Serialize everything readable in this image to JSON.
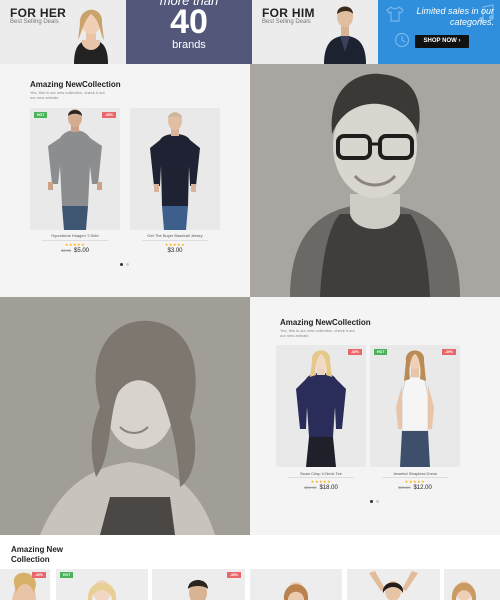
{
  "banner": {
    "her": {
      "title": "FOR HER",
      "subtitle": "Best Selling Deals"
    },
    "brands": {
      "top": "more than",
      "number": "40",
      "bottom": "brands"
    },
    "him": {
      "title": "FOR HIM",
      "subtitle": "Best Selling Deals"
    },
    "sale": {
      "text": "Limited sales in our categories.",
      "button": "SHOP NOW ›",
      "icons": [
        "t-shirt-icon",
        "music-note-icon",
        "clock-icon"
      ]
    }
  },
  "collection_1": {
    "title": "Amazing NewCollection",
    "description": "Yes, this is our new collection, check it out our new arrivals",
    "products": [
      {
        "name": "Hyundreds Hoagen T-Shirt",
        "badge_left": "HOT",
        "badge_right": "-30%",
        "stars": "★★★★★",
        "old_price": "$5.00",
        "price": "$5.00"
      },
      {
        "name": "Get The Buyer Baseball Jersey",
        "badge_left": "",
        "badge_right": "",
        "stars": "★★★★★",
        "old_price": "",
        "price": "$3.00"
      }
    ]
  },
  "collection_2": {
    "title": "Amazing NewCollection",
    "description": "Yes, this is our new collection, check it out our new arrivals",
    "products": [
      {
        "name": "Swan Crisp V-Neck Tee",
        "badge_left": "",
        "badge_right": "-30%",
        "stars": "★★★★★",
        "old_price": "$20.00",
        "price": "$18.00"
      },
      {
        "name": "Jeweled Strapless Dress",
        "badge_left": "HOT",
        "badge_right": "-30%",
        "stars": "★★★★★",
        "old_price": "$15.00",
        "price": "$12.00"
      }
    ]
  },
  "bottom": {
    "title": "Amazing New Collection",
    "badges": [
      "-30%",
      "HOT",
      "-30%"
    ]
  },
  "colors": {
    "brands_bg": "#53577a",
    "sale_bg": "#2f8fdc",
    "hot": "#4db35a",
    "sale_badge": "#e9666a",
    "stars": "#f2b01e"
  }
}
